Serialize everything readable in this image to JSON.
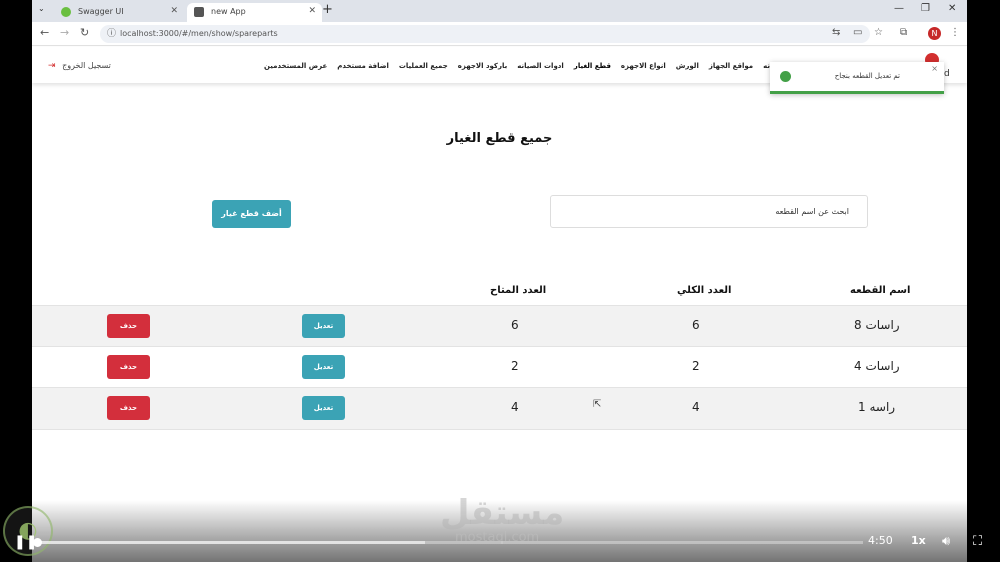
{
  "browser": {
    "tabs": [
      {
        "title": "Swagger UI",
        "favicon_color": "#6abf40"
      },
      {
        "title": "new App",
        "favicon_color": "#555555"
      }
    ],
    "url": "localhost:3000/#/men/show/spareparts"
  },
  "appnav": {
    "logout_label": "تسجيل الخروج",
    "menu": [
      "سيانه",
      "مواقع الجهاز",
      "الورش",
      "انواع الاجهزه",
      "قطع الغيار",
      "ادوات الصيانه",
      "باركود الاجهزه",
      "جميع العمليات",
      "اضافة مستخدم",
      "عرض المستخدمين"
    ],
    "brand_edge": "d"
  },
  "toast": {
    "message": "تم تعديل القطعه بنجاح",
    "close": "×"
  },
  "page": {
    "title": "جميع قطع الغيار",
    "search_placeholder": "ابحث عن اسم القطعه",
    "add_button": "أضف قطع غيار"
  },
  "table": {
    "headers": {
      "name": "اسم القطعه",
      "total": "العدد الكلي",
      "available": "العدد المتاح"
    },
    "rows": [
      {
        "name": "راسات 8",
        "total": "6",
        "available": "6"
      },
      {
        "name": "راسات 4",
        "total": "2",
        "available": "2"
      },
      {
        "name": "راسه 1",
        "total": "4",
        "available": "4"
      }
    ],
    "edit_label": "تعديل",
    "delete_label": "حذف"
  },
  "player": {
    "time": "4:50",
    "speed": "1x",
    "progress": 0.46,
    "buffered": 0.47,
    "watermark": "مستقل",
    "watermark_sub": "mostaql.com"
  }
}
